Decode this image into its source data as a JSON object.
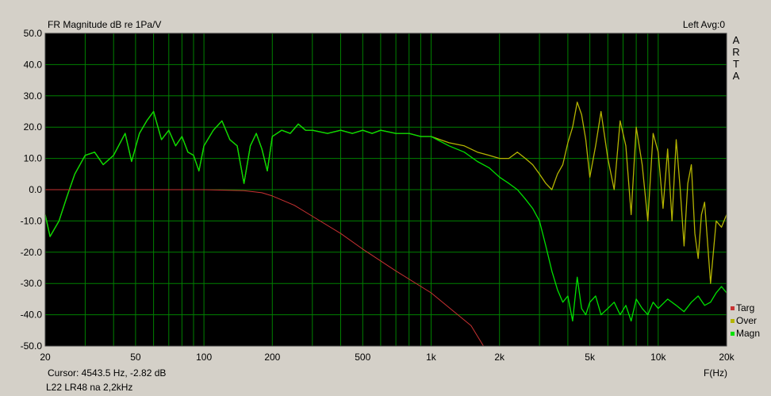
{
  "header": {
    "title": "FR Magnitude dB re 1Pa/V",
    "avg_label": "Left Avg:0",
    "brand_letters": [
      "A",
      "R",
      "T",
      "A"
    ]
  },
  "footer": {
    "cursor": "Cursor:  4543.5 Hz, -2.82 dB",
    "note": "L22 LR48 na 2,2kHz",
    "x_unit": "F(Hz)"
  },
  "legend": [
    {
      "name": "Targ",
      "color": "#c83232"
    },
    {
      "name": "Over",
      "color": "#b4b400"
    },
    {
      "name": "Magn",
      "color": "#00e000"
    }
  ],
  "colors": {
    "plot_bg": "#000000",
    "grid": "#008000",
    "targ": "#c83232",
    "over": "#b4b400",
    "magn": "#00e000"
  },
  "chart_data": {
    "type": "line",
    "x_scale": "log",
    "xlim": [
      20,
      20000
    ],
    "ylim": [
      -50,
      50
    ],
    "grid": true,
    "legend_position": "bottom-right",
    "xticks": [
      20,
      50,
      100,
      200,
      500,
      1000,
      2000,
      5000,
      10000,
      20000
    ],
    "xtick_labels": [
      "20",
      "50",
      "100",
      "200",
      "500",
      "1k",
      "2k",
      "5k",
      "10k",
      "20k"
    ],
    "yticks": [
      50,
      40,
      30,
      20,
      10,
      0,
      -10,
      -20,
      -30,
      -40,
      -50
    ],
    "ytick_labels": [
      "50.0",
      "40.0",
      "30.0",
      "20.0",
      "10.0",
      "0.0",
      "-10.0",
      "-20.0",
      "-30.0",
      "-40.0",
      "-50.0"
    ],
    "series": [
      {
        "name": "Targ",
        "x": [
          20,
          50,
          100,
          150,
          180,
          200,
          250,
          300,
          400,
          500,
          700,
          1000,
          1500,
          1700
        ],
        "y": [
          0,
          0,
          0,
          -0.3,
          -1,
          -2,
          -5,
          -8.5,
          -14,
          -19,
          -26,
          -33,
          -43.5,
          -50
        ]
      },
      {
        "name": "Over",
        "x": [
          20,
          21,
          23,
          25,
          27,
          30,
          33,
          36,
          40,
          45,
          48,
          52,
          56,
          60,
          65,
          70,
          75,
          80,
          85,
          90,
          95,
          100,
          110,
          120,
          130,
          140,
          150,
          160,
          170,
          180,
          190,
          200,
          220,
          240,
          260,
          280,
          300,
          350,
          400,
          450,
          500,
          550,
          600,
          700,
          800,
          900,
          1000,
          1200,
          1400,
          1600,
          1800,
          2000,
          2200,
          2400,
          2600,
          2800,
          3000,
          3200,
          3400,
          3600,
          3800,
          4000,
          4200,
          4400,
          4600,
          4800,
          5000,
          5300,
          5600,
          6000,
          6400,
          6800,
          7200,
          7600,
          8000,
          8500,
          9000,
          9500,
          10000,
          10500,
          11000,
          11500,
          12000,
          12500,
          13000,
          13500,
          14000,
          14500,
          15000,
          15500,
          16000,
          17000,
          18000,
          19000,
          20000
        ],
        "y": [
          -8,
          -15,
          -10,
          -2,
          5,
          11,
          12,
          8,
          11,
          18,
          9,
          18,
          22,
          25,
          16,
          19,
          14,
          17,
          12,
          11,
          6,
          14,
          19,
          22,
          16,
          14,
          2,
          14,
          18,
          13,
          6,
          17,
          19,
          18,
          21,
          19,
          19,
          18,
          19,
          18,
          19,
          18,
          19,
          18,
          18,
          17,
          17,
          15,
          14,
          12,
          11,
          10,
          10,
          12,
          10,
          8,
          5,
          2,
          0,
          5,
          8,
          15,
          20,
          28,
          24,
          16,
          4,
          14,
          25,
          10,
          0,
          22,
          14,
          -8,
          20,
          8,
          -10,
          18,
          12,
          -6,
          13,
          -10,
          16,
          0,
          -18,
          2,
          8,
          -14,
          -22,
          -8,
          -4,
          -30,
          -10,
          -12,
          -8
        ]
      },
      {
        "name": "Magn",
        "x": [
          20,
          21,
          23,
          25,
          27,
          30,
          33,
          36,
          40,
          45,
          48,
          52,
          56,
          60,
          65,
          70,
          75,
          80,
          85,
          90,
          95,
          100,
          110,
          120,
          130,
          140,
          150,
          160,
          170,
          180,
          190,
          200,
          220,
          240,
          260,
          280,
          300,
          350,
          400,
          450,
          500,
          550,
          600,
          700,
          800,
          900,
          1000,
          1200,
          1400,
          1600,
          1800,
          2000,
          2200,
          2400,
          2600,
          2800,
          3000,
          3200,
          3400,
          3600,
          3800,
          4000,
          4200,
          4400,
          4600,
          4800,
          5000,
          5300,
          5600,
          6000,
          6400,
          6800,
          7200,
          7600,
          8000,
          8500,
          9000,
          9500,
          10000,
          11000,
          12000,
          13000,
          14000,
          15000,
          16000,
          17000,
          18000,
          19000,
          20000
        ],
        "y": [
          -8,
          -15,
          -10,
          -2,
          5,
          11,
          12,
          8,
          11,
          18,
          9,
          18,
          22,
          25,
          16,
          19,
          14,
          17,
          12,
          11,
          6,
          14,
          19,
          22,
          16,
          14,
          2,
          14,
          18,
          13,
          6,
          17,
          19,
          18,
          21,
          19,
          19,
          18,
          19,
          18,
          19,
          18,
          19,
          18,
          18,
          17,
          17,
          14,
          12,
          9,
          7,
          4,
          2,
          0,
          -3,
          -6,
          -10,
          -18,
          -26,
          -32,
          -36,
          -34,
          -42,
          -28,
          -38,
          -40,
          -36,
          -34,
          -40,
          -38,
          -36,
          -40,
          -37,
          -42,
          -35,
          -38,
          -40,
          -36,
          -38,
          -35,
          -37,
          -39,
          -36,
          -34,
          -37,
          -36,
          -33,
          -31,
          -33
        ]
      }
    ]
  }
}
